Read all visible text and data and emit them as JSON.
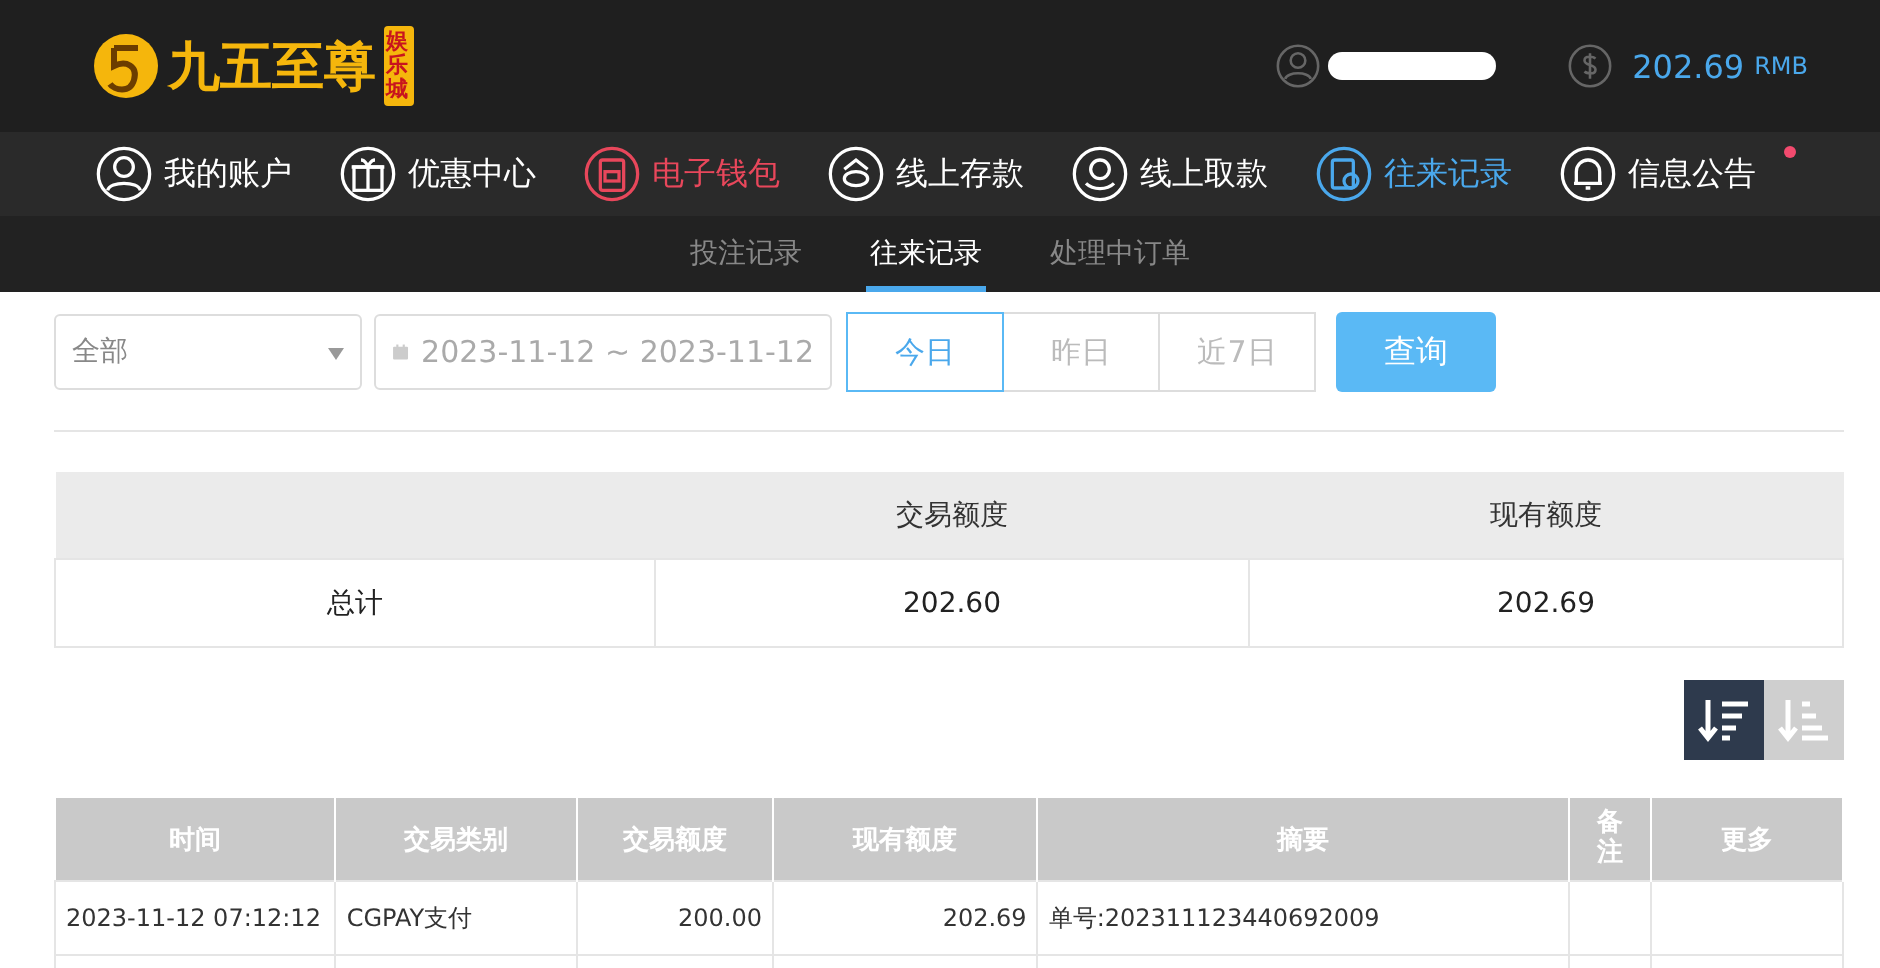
{
  "header": {
    "logo_text": "九五至尊",
    "logo_badge": "娱乐城",
    "balance": "202.69",
    "currency": "RMB"
  },
  "nav": [
    {
      "label": "我的账户",
      "kind": "user",
      "color": "#ffffff",
      "notification": false
    },
    {
      "label": "优惠中心",
      "kind": "gift",
      "color": "#ffffff",
      "notification": false
    },
    {
      "label": "电子钱包",
      "kind": "wallet",
      "color": "#e8475b",
      "notification": false
    },
    {
      "label": "线上存款",
      "kind": "deposit",
      "color": "#ffffff",
      "notification": false
    },
    {
      "label": "线上取款",
      "kind": "withdraw",
      "color": "#ffffff",
      "notification": false
    },
    {
      "label": "往来记录",
      "kind": "record",
      "color": "#4aa8ec",
      "notification": false
    },
    {
      "label": "信息公告",
      "kind": "bell",
      "color": "#ffffff",
      "notification": true
    }
  ],
  "subtabs": [
    {
      "label": "投注记录",
      "selected": false
    },
    {
      "label": "往来记录",
      "selected": true
    },
    {
      "label": "处理中订单",
      "selected": false
    }
  ],
  "filter": {
    "type_select": "全部",
    "date_range": "2023-11-12 ~ 2023-11-12",
    "ranges": [
      {
        "label": "今日",
        "selected": true
      },
      {
        "label": "昨日",
        "selected": false
      },
      {
        "label": "近7日",
        "selected": false
      }
    ],
    "query_button": "查询"
  },
  "summary": {
    "columns": [
      "交易额度",
      "现有额度"
    ],
    "row": {
      "label": "总计",
      "values": [
        "202.60",
        "202.69"
      ]
    }
  },
  "sort": [
    {
      "selected": true
    },
    {
      "selected": false
    }
  ],
  "table": {
    "columns": [
      "时间",
      "交易类别",
      "交易额度",
      "现有额度",
      "摘要",
      "备注",
      "更多"
    ],
    "rows": [
      [
        "2023-11-12 07:12:12",
        "CGPAY支付",
        "200.00",
        "202.69",
        "单号:202311123440692009",
        "",
        ""
      ]
    ]
  }
}
